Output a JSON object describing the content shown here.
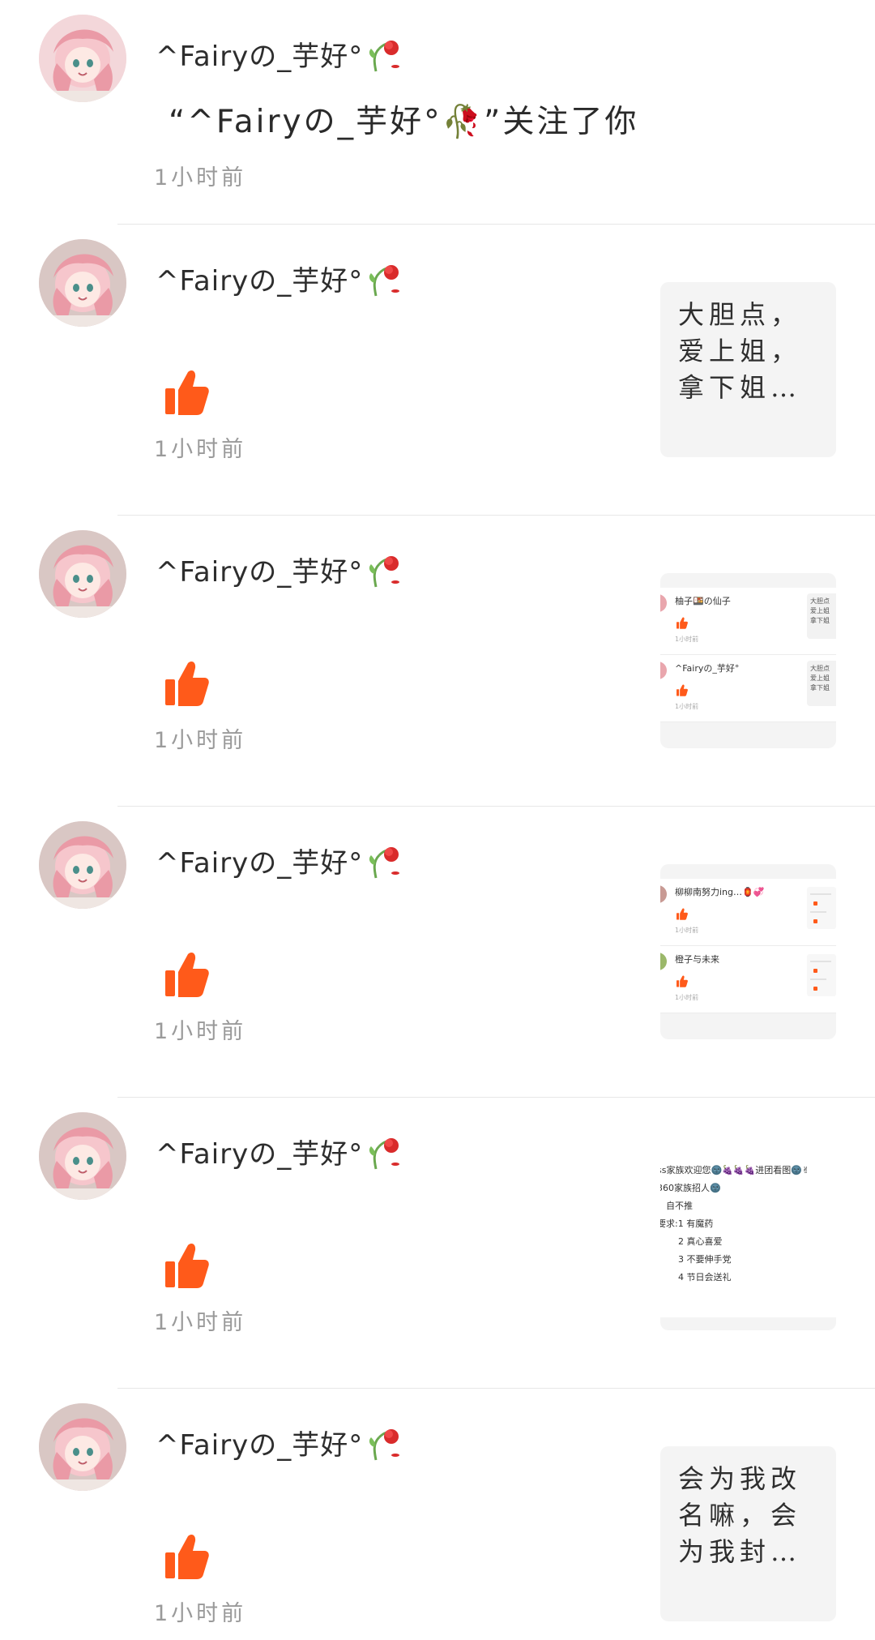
{
  "feed": {
    "items": [
      {
        "type": "follow",
        "username": "^Fairyの_芋好°",
        "message": "“^Fairyの_芋好°🥀”关注了你",
        "time": "1小时前"
      },
      {
        "type": "like",
        "username": "^Fairyの_芋好°",
        "time": "1小时前",
        "preview": {
          "kind": "text",
          "text": "大胆点，爱上姐，拿下姐…"
        }
      },
      {
        "type": "like",
        "username": "^Fairyの_芋好°",
        "time": "1小时前",
        "preview": {
          "kind": "mini-feed",
          "rows": [
            {
              "name": "柚子🍱の仙子",
              "time": "1小时前",
              "box_text": "大胆点\n爱上姐\n拿下姐"
            },
            {
              "name": "^Fairyの_芋好°",
              "time": "1小时前",
              "box_text": "大胆点\n爱上姐\n拿下姐"
            }
          ]
        }
      },
      {
        "type": "like",
        "username": "^Fairyの_芋好°",
        "time": "1小时前",
        "preview": {
          "kind": "mini-feed-2",
          "rows": [
            {
              "name": "柳柳南努力ing…🏮💞",
              "time": "1小时前"
            },
            {
              "name": "橙子与未来",
              "time": "1小时前"
            }
          ]
        }
      },
      {
        "type": "like",
        "username": "^Fairyの_芋好°",
        "time": "1小时前",
        "preview": {
          "kind": "post-text",
          "lines": [
            "ss家族欢迎您🌚🍇🍇🍇进团看图🌚✌",
            "360家族招人🌚",
            "、自不推",
            "要求:1 有魔药",
            "2 真心喜爱",
            "3 不要伸手党",
            "4 节日会送礼"
          ]
        }
      },
      {
        "type": "like",
        "username": "^Fairyの_芋好°",
        "time": "1小时前",
        "preview": {
          "kind": "text",
          "text": "会为我改名嘛，会为我封…"
        }
      }
    ]
  },
  "colors": {
    "accent": "#ff5a1a",
    "divider": "#e7e7e7",
    "time": "#9a9a9a",
    "preview_bg": "#f4f4f4"
  },
  "icons": {
    "avatar": "anime-girl-avatar",
    "like": "thumbs-up-icon",
    "flower": "wilted-rose-icon"
  }
}
